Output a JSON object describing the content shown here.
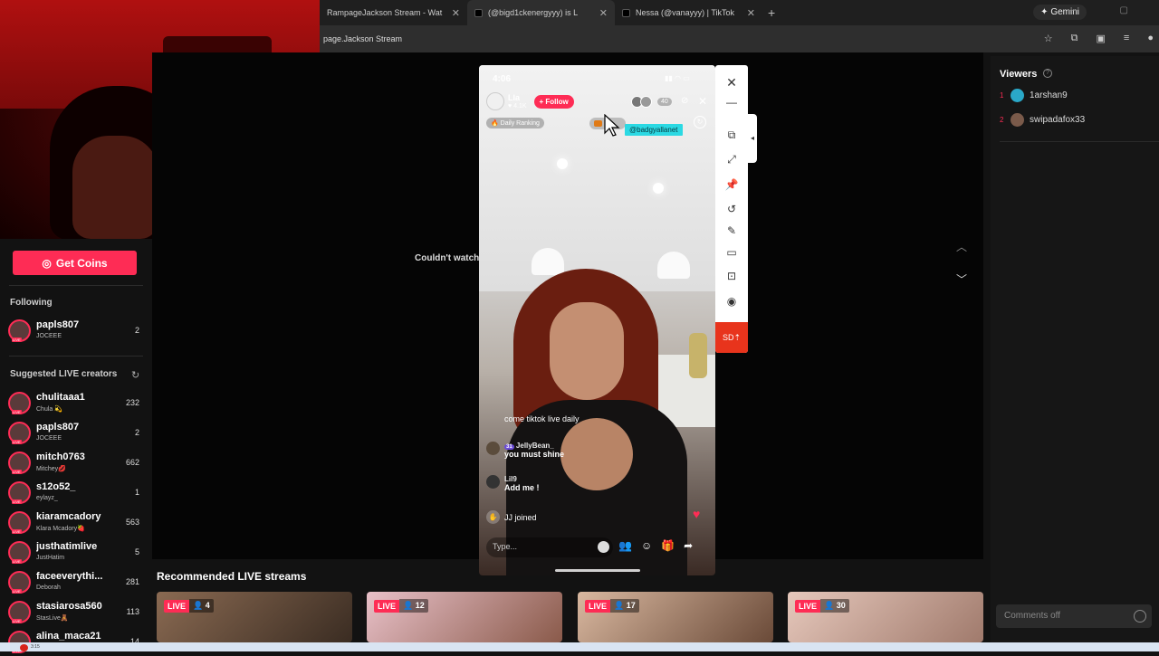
{
  "browser": {
    "tabs": [
      {
        "title": "RampageJackson Stream - Wat"
      },
      {
        "title": "(@bigd1ckenergyyy) is L"
      },
      {
        "title": "Nessa (@vanayyy) | TikTok"
      }
    ],
    "new_tab": "+",
    "gemini_label": "Gemini",
    "url": "page.Jackson Stream"
  },
  "sidebar": {
    "get_coins": "Get Coins",
    "following_title": "Following",
    "following": [
      {
        "name": "papls807",
        "sub": "JOCEEE",
        "count": "2"
      }
    ],
    "suggested_title": "Suggested LIVE creators",
    "suggested": [
      {
        "name": "chulitaaa1",
        "sub": "Chula 💫",
        "count": "232"
      },
      {
        "name": "papls807",
        "sub": "JOCEEE",
        "count": "2"
      },
      {
        "name": "mitch0763",
        "sub": "Mitchey💋",
        "count": "662"
      },
      {
        "name": "s12o52_",
        "sub": "eylayz_",
        "count": "1"
      },
      {
        "name": "kiaramcadory",
        "sub": "Klara Mcadory🍓",
        "count": "563"
      },
      {
        "name": "justhatimlive",
        "sub": "JustHatim",
        "count": "5"
      },
      {
        "name": "faceeverythi...",
        "sub": "Deborah",
        "count": "281"
      },
      {
        "name": "stasiarosa560",
        "sub": "StasLive🧸",
        "count": "113"
      },
      {
        "name": "alina_maca21",
        "sub": "",
        "count": "14"
      }
    ],
    "live_tag": "LIVE"
  },
  "stage": {
    "error_text": "Couldn't watch"
  },
  "phone": {
    "time": "4:06",
    "host_name": "Lla",
    "host_likes": "4.1K",
    "follow_label": "+ Follow",
    "viewer_count": "40",
    "daily_ranking": "Daily Ranking",
    "mention": "@badgyallanet",
    "chat": [
      {
        "user": "JellyBean_",
        "text": "come tiktok live daily",
        "badge": ""
      },
      {
        "user": "JellyBean_",
        "text": "you must shine",
        "badge": "31"
      },
      {
        "user": "Lil9",
        "text": "Add me !",
        "badge": ""
      }
    ],
    "joined": "JJ joined",
    "input_placeholder": "Type..."
  },
  "tools": {
    "sd_label": "SD"
  },
  "recommended": {
    "title": "Recommended LIVE streams",
    "cards": [
      {
        "live": "LIVE",
        "viewers": "4"
      },
      {
        "live": "LIVE",
        "viewers": "12"
      },
      {
        "live": "LIVE",
        "viewers": "17"
      },
      {
        "live": "LIVE",
        "viewers": "30"
      }
    ]
  },
  "viewers": {
    "title": "Viewers",
    "list": [
      {
        "rank": "1",
        "name": "1arshan9"
      },
      {
        "rank": "2",
        "name": "swipadafox33"
      }
    ],
    "comments_off": "Comments off"
  },
  "taskbar": {
    "rec_time": "3:15"
  }
}
